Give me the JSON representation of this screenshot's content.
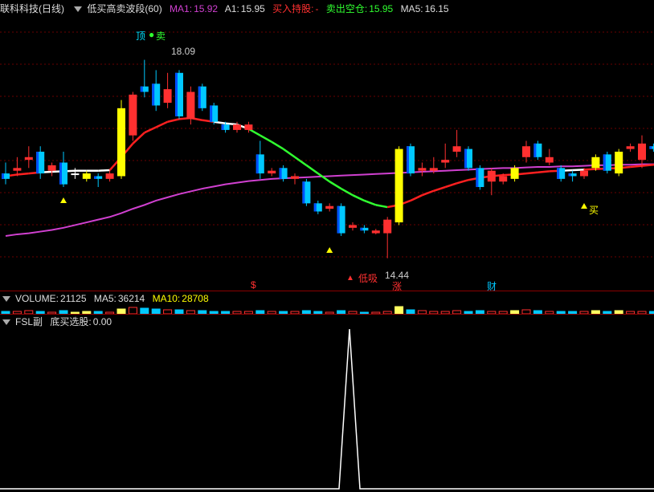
{
  "header": {
    "stock_name": "联科科技",
    "period": "(日线)",
    "indicator_name": "低买高卖波段(60)",
    "ma1_label": "MA1:",
    "ma1_value": "15.92",
    "a1_label": "A1:",
    "a1_value": "15.95",
    "buy_hold_label": "买入持股:",
    "buy_hold_value": "-",
    "sell_clear_label": "卖出空仓:",
    "sell_clear_value": "15.95",
    "ma5_label": "MA5:",
    "ma5_value": "16.15"
  },
  "annotations": {
    "top": "顶",
    "sell": "卖",
    "high_price": "18.09",
    "low_price": "14.44",
    "low_suck": "低吸",
    "buy1": "买",
    "buy2": "买",
    "marker_s": "$",
    "marker_zhang": "涨",
    "marker_cai": "财"
  },
  "volume": {
    "label": "VOLUME:",
    "value": "21125",
    "ma5_label": "MA5:",
    "ma5_value": "36214",
    "ma10_label": "MA10:",
    "ma10_value": "28708"
  },
  "fsl": {
    "label": "FSL副",
    "signal_label": "底买选股:",
    "signal_value": "0.00"
  },
  "colors": {
    "up": "#ff3030",
    "down": "#00c8ff",
    "highlight": "#ffff00",
    "ma_purple": "#d040d0",
    "trend_red": "#ff2020",
    "trend_green": "#30ff30",
    "trend_white": "#ffffff"
  },
  "chart_data": {
    "type": "candlestick",
    "price_axis_range": [
      14.2,
      18.6
    ],
    "candles": [
      {
        "o": 16.0,
        "c": 15.9,
        "h": 16.2,
        "l": 15.8,
        "color": "down"
      },
      {
        "o": 16.05,
        "c": 16.1,
        "h": 16.3,
        "l": 15.95,
        "color": "up"
      },
      {
        "o": 16.25,
        "c": 16.3,
        "h": 16.5,
        "l": 16.1,
        "color": "up"
      },
      {
        "o": 16.4,
        "c": 16.0,
        "h": 16.5,
        "l": 15.9,
        "color": "down"
      },
      {
        "o": 16.05,
        "c": 16.15,
        "h": 16.2,
        "l": 15.95,
        "color": "up"
      },
      {
        "o": 16.2,
        "c": 15.8,
        "h": 16.4,
        "l": 15.75,
        "color": "down"
      },
      {
        "o": 16.0,
        "c": 16.0,
        "h": 16.1,
        "l": 15.9,
        "color": "white"
      },
      {
        "o": 15.9,
        "c": 16.0,
        "h": 16.05,
        "l": 15.85,
        "color": "yellow"
      },
      {
        "o": 15.95,
        "c": 15.9,
        "h": 16.0,
        "l": 15.75,
        "color": "down"
      },
      {
        "o": 15.9,
        "c": 16.0,
        "h": 16.05,
        "l": 15.85,
        "color": "up"
      },
      {
        "o": 15.95,
        "c": 17.2,
        "h": 17.35,
        "l": 15.9,
        "color": "yellow"
      },
      {
        "o": 16.7,
        "c": 17.45,
        "h": 17.5,
        "l": 16.6,
        "color": "up"
      },
      {
        "o": 17.6,
        "c": 17.5,
        "h": 18.09,
        "l": 17.4,
        "color": "down"
      },
      {
        "o": 17.65,
        "c": 17.25,
        "h": 17.9,
        "l": 17.15,
        "color": "down"
      },
      {
        "o": 17.3,
        "c": 17.55,
        "h": 17.85,
        "l": 17.2,
        "color": "up"
      },
      {
        "o": 17.85,
        "c": 17.05,
        "h": 17.9,
        "l": 17.0,
        "color": "down"
      },
      {
        "o": 17.0,
        "c": 17.5,
        "h": 17.6,
        "l": 16.9,
        "color": "up"
      },
      {
        "o": 17.6,
        "c": 17.2,
        "h": 17.65,
        "l": 17.15,
        "color": "down"
      },
      {
        "o": 17.25,
        "c": 16.95,
        "h": 17.3,
        "l": 16.9,
        "color": "down"
      },
      {
        "o": 16.9,
        "c": 16.8,
        "h": 16.95,
        "l": 16.75,
        "color": "down"
      },
      {
        "o": 16.8,
        "c": 16.9,
        "h": 16.95,
        "l": 16.75,
        "color": "up"
      },
      {
        "o": 16.9,
        "c": 16.8,
        "h": 16.95,
        "l": 16.75,
        "color": "up"
      },
      {
        "o": 16.35,
        "c": 16.0,
        "h": 16.6,
        "l": 15.9,
        "color": "down"
      },
      {
        "o": 16.0,
        "c": 16.05,
        "h": 16.1,
        "l": 15.95,
        "color": "up"
      },
      {
        "o": 16.1,
        "c": 15.9,
        "h": 16.15,
        "l": 15.85,
        "color": "down"
      },
      {
        "o": 15.95,
        "c": 15.9,
        "h": 16.0,
        "l": 15.8,
        "color": "up"
      },
      {
        "o": 15.85,
        "c": 15.45,
        "h": 15.9,
        "l": 15.4,
        "color": "down"
      },
      {
        "o": 15.45,
        "c": 15.3,
        "h": 15.5,
        "l": 15.25,
        "color": "down"
      },
      {
        "o": 15.4,
        "c": 15.35,
        "h": 15.45,
        "l": 15.3,
        "color": "up"
      },
      {
        "o": 15.4,
        "c": 14.9,
        "h": 15.45,
        "l": 14.85,
        "color": "down"
      },
      {
        "o": 15.05,
        "c": 15.0,
        "h": 15.1,
        "l": 14.95,
        "color": "up"
      },
      {
        "o": 15.0,
        "c": 14.95,
        "h": 15.05,
        "l": 14.9,
        "color": "down"
      },
      {
        "o": 14.95,
        "c": 14.9,
        "h": 14.98,
        "l": 14.88,
        "color": "up"
      },
      {
        "o": 14.9,
        "c": 15.15,
        "h": 15.2,
        "l": 14.44,
        "color": "up"
      },
      {
        "o": 15.1,
        "c": 16.45,
        "h": 16.5,
        "l": 15.05,
        "color": "yellow"
      },
      {
        "o": 16.5,
        "c": 16.0,
        "h": 16.55,
        "l": 15.95,
        "color": "down"
      },
      {
        "o": 16.05,
        "c": 16.1,
        "h": 16.2,
        "l": 15.95,
        "color": "up"
      },
      {
        "o": 16.1,
        "c": 16.05,
        "h": 16.3,
        "l": 16.0,
        "color": "up"
      },
      {
        "o": 16.2,
        "c": 16.25,
        "h": 16.55,
        "l": 16.1,
        "color": "up"
      },
      {
        "o": 16.4,
        "c": 16.5,
        "h": 16.8,
        "l": 16.3,
        "color": "up"
      },
      {
        "o": 16.45,
        "c": 16.1,
        "h": 16.5,
        "l": 16.05,
        "color": "down"
      },
      {
        "o": 16.1,
        "c": 15.75,
        "h": 16.15,
        "l": 15.7,
        "color": "down"
      },
      {
        "o": 15.85,
        "c": 16.05,
        "h": 16.1,
        "l": 15.6,
        "color": "up"
      },
      {
        "o": 15.95,
        "c": 15.85,
        "h": 16.0,
        "l": 15.8,
        "color": "up"
      },
      {
        "o": 15.9,
        "c": 16.1,
        "h": 16.15,
        "l": 15.85,
        "color": "yellow"
      },
      {
        "o": 16.3,
        "c": 16.5,
        "h": 16.6,
        "l": 16.2,
        "color": "up"
      },
      {
        "o": 16.55,
        "c": 16.3,
        "h": 16.6,
        "l": 16.25,
        "color": "down"
      },
      {
        "o": 16.2,
        "c": 16.3,
        "h": 16.45,
        "l": 16.15,
        "color": "up"
      },
      {
        "o": 16.1,
        "c": 15.9,
        "h": 16.15,
        "l": 15.85,
        "color": "down"
      },
      {
        "o": 16.0,
        "c": 15.95,
        "h": 16.05,
        "l": 15.85,
        "color": "down"
      },
      {
        "o": 15.95,
        "c": 16.05,
        "h": 16.1,
        "l": 15.9,
        "color": "up"
      },
      {
        "o": 16.1,
        "c": 16.3,
        "h": 16.35,
        "l": 16.05,
        "color": "yellow"
      },
      {
        "o": 16.35,
        "c": 16.05,
        "h": 16.4,
        "l": 16.0,
        "color": "down"
      },
      {
        "o": 16.0,
        "c": 16.4,
        "h": 16.45,
        "l": 15.95,
        "color": "yellow"
      },
      {
        "o": 16.45,
        "c": 16.5,
        "h": 16.55,
        "l": 16.4,
        "color": "up"
      },
      {
        "o": 16.25,
        "c": 16.55,
        "h": 16.7,
        "l": 16.1,
        "color": "up"
      },
      {
        "o": 16.5,
        "c": 16.45,
        "h": 16.55,
        "l": 16.4,
        "color": "down"
      },
      {
        "o": 16.45,
        "c": 16.45,
        "h": 16.5,
        "l": 16.4,
        "color": "up"
      }
    ],
    "ma_purple": [
      14.85,
      14.88,
      14.9,
      14.93,
      14.96,
      15.0,
      15.05,
      15.1,
      15.15,
      15.2,
      15.27,
      15.35,
      15.42,
      15.5,
      15.56,
      15.62,
      15.67,
      15.72,
      15.76,
      15.8,
      15.83,
      15.86,
      15.88,
      15.9,
      15.91,
      15.92,
      15.93,
      15.94,
      15.95,
      15.96,
      15.97,
      15.98,
      15.99,
      16.0,
      16.01,
      16.02,
      16.03,
      16.04,
      16.05,
      16.06,
      16.07,
      16.08,
      16.09,
      16.1,
      16.1,
      16.11,
      16.12,
      16.12,
      16.13,
      16.13,
      16.14,
      16.15,
      16.15,
      16.16,
      16.16,
      16.17,
      16.17,
      16.18
    ],
    "trend_line": [
      15.95,
      15.98,
      16.0,
      16.02,
      16.03,
      16.04,
      16.05,
      16.05,
      16.05,
      16.06,
      16.3,
      16.55,
      16.75,
      16.85,
      16.95,
      17.0,
      17.02,
      16.98,
      16.95,
      16.92,
      16.9,
      16.82,
      16.7,
      16.58,
      16.45,
      16.3,
      16.15,
      16.0,
      15.85,
      15.72,
      15.6,
      15.5,
      15.42,
      15.38,
      15.42,
      15.5,
      15.6,
      15.68,
      15.75,
      15.82,
      15.88,
      15.92,
      15.95,
      15.97,
      15.98,
      16.0,
      16.02,
      16.04,
      16.05,
      16.06,
      16.07,
      16.08,
      16.09,
      16.1,
      16.12,
      16.14,
      16.16,
      16.18
    ],
    "trend_colors": [
      "red",
      "red",
      "red",
      "red",
      "white",
      "white",
      "white",
      "white",
      "white",
      "white",
      "red",
      "red",
      "red",
      "red",
      "red",
      "red",
      "red",
      "red",
      "red",
      "white",
      "white",
      "white",
      "green",
      "green",
      "green",
      "green",
      "green",
      "green",
      "green",
      "green",
      "green",
      "green",
      "green",
      "green",
      "red",
      "red",
      "red",
      "red",
      "red",
      "red",
      "red",
      "red",
      "red",
      "red",
      "red",
      "red",
      "red",
      "red",
      "red",
      "white",
      "white",
      "red",
      "red",
      "red",
      "red",
      "red",
      "red",
      "red"
    ],
    "volume": [
      3,
      3,
      4,
      3,
      2,
      4,
      2,
      3,
      3,
      2,
      6,
      8,
      7,
      6,
      5,
      5,
      4,
      4,
      3,
      3,
      3,
      3,
      4,
      3,
      3,
      3,
      4,
      3,
      2,
      4,
      3,
      2,
      2,
      3,
      9,
      5,
      4,
      3,
      3,
      4,
      3,
      4,
      3,
      3,
      4,
      5,
      4,
      3,
      3,
      3,
      3,
      4,
      3,
      4,
      3,
      3,
      3,
      3
    ],
    "fsl_signal": [
      0,
      0,
      0,
      0,
      0,
      0,
      0,
      0,
      0,
      0,
      0,
      0,
      0,
      0,
      0,
      0,
      0,
      0,
      0,
      0,
      0,
      0,
      0,
      0,
      0,
      0,
      0,
      0,
      0,
      0,
      0,
      0,
      0,
      0,
      0,
      0,
      0,
      0,
      0,
      0,
      0,
      0,
      0,
      0,
      0,
      0,
      0,
      0,
      0,
      0,
      0,
      0,
      0,
      0,
      0,
      0,
      0,
      0
    ],
    "fsl_spike_index": 33,
    "fsl_spike_value": 1
  }
}
